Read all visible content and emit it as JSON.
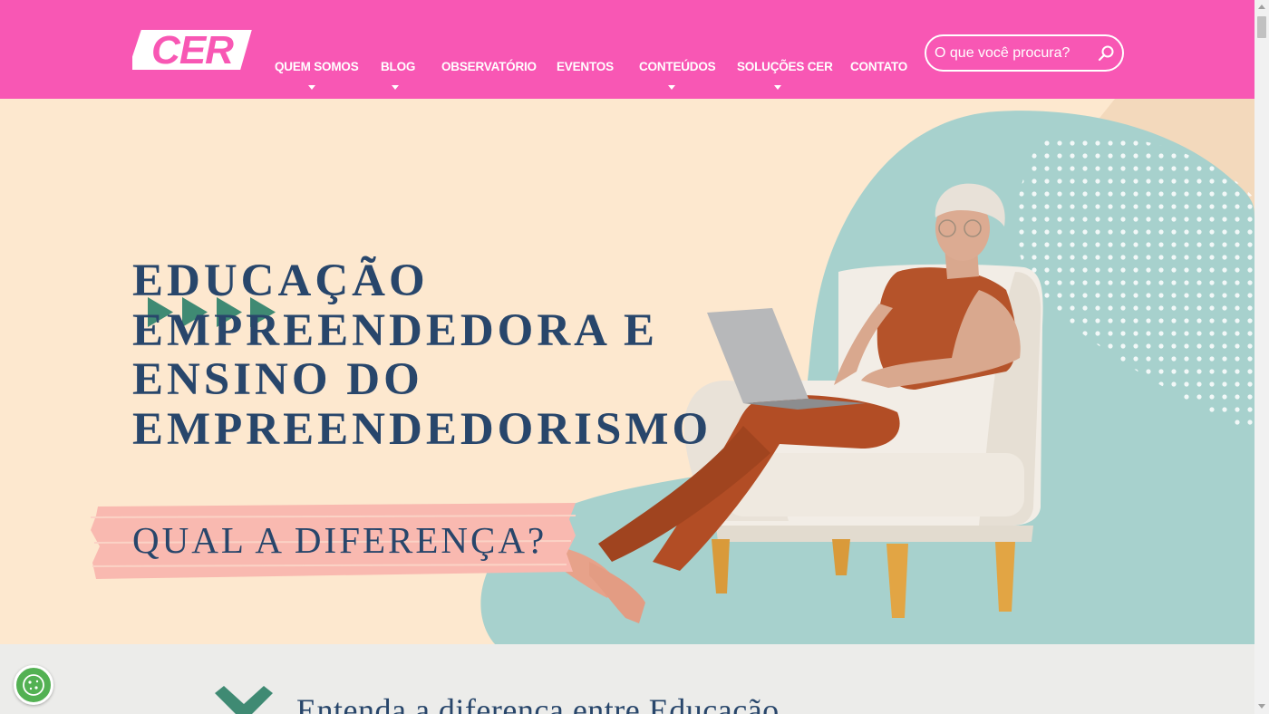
{
  "header": {
    "logo_text": "CER",
    "nav": [
      {
        "label": "QUEM SOMOS",
        "has_dropdown": true
      },
      {
        "label": "BLOG",
        "has_dropdown": true
      },
      {
        "label": "OBSERVATÓRIO",
        "has_dropdown": false
      },
      {
        "label": "EVENTOS",
        "has_dropdown": false
      },
      {
        "label": "CONTEÚDOS",
        "has_dropdown": true
      },
      {
        "label": "SOLUÇÕES CER",
        "has_dropdown": true
      },
      {
        "label": "CONTATO",
        "has_dropdown": false
      }
    ],
    "search": {
      "placeholder": "O que você procura?",
      "icon": "search-icon"
    }
  },
  "hero": {
    "headline_lines": [
      "EDUCAÇÃO",
      "EMPREENDEDORA E",
      "ENSINO DO",
      "EMPREENDEDORISMO"
    ],
    "subheadline": "QUAL A DIFERENÇA?",
    "decor_icon": "play-arrows-icon",
    "image": "woman-with-laptop-in-armchair"
  },
  "section": {
    "teaser": "Entenda a diferença entre Educação",
    "icon": "chevron-down-icon"
  },
  "cookie_button": {
    "icon": "cookie-icon"
  },
  "colors": {
    "header_bg": "#f857b4",
    "hero_bg": "#fde8cf",
    "teal_blob": "#a7d1cd",
    "headline": "#28466b",
    "arrows": "#3f8a73",
    "brush": "#f9b9b0",
    "cookie": "#53b153"
  }
}
